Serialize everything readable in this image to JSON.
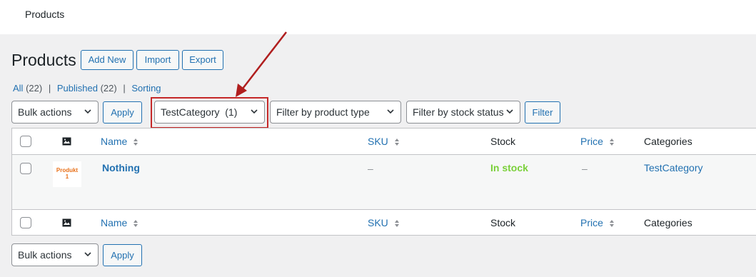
{
  "topbar": {
    "title": "Products"
  },
  "header": {
    "title": "Products",
    "add_new": "Add New",
    "import": "Import",
    "export": "Export"
  },
  "views": {
    "all_label": "All",
    "all_count": "(22)",
    "published_label": "Published",
    "published_count": "(22)",
    "sorting_label": "Sorting",
    "separator": "|"
  },
  "filters": {
    "bulk_actions": "Bulk actions",
    "apply": "Apply",
    "category": "TestCategory  (1)",
    "product_type": "Filter by product type",
    "stock_status": "Filter by stock status",
    "filter_button": "Filter"
  },
  "table": {
    "columns": {
      "name": "Name",
      "sku": "SKU",
      "stock": "Stock",
      "price": "Price",
      "categories": "Categories"
    },
    "rows": [
      {
        "thumb_text_line1": "Produkt",
        "thumb_text_line2": "1",
        "name": "Nothing",
        "sku": "–",
        "stock": "In stock",
        "price": "–",
        "category": "TestCategory"
      }
    ]
  },
  "colors": {
    "accent": "#2271b1",
    "in_stock": "#7ad03a",
    "highlight": "#c62828",
    "arrow": "#b01e1e"
  },
  "bottom": {
    "bulk_actions": "Bulk actions",
    "apply": "Apply"
  }
}
